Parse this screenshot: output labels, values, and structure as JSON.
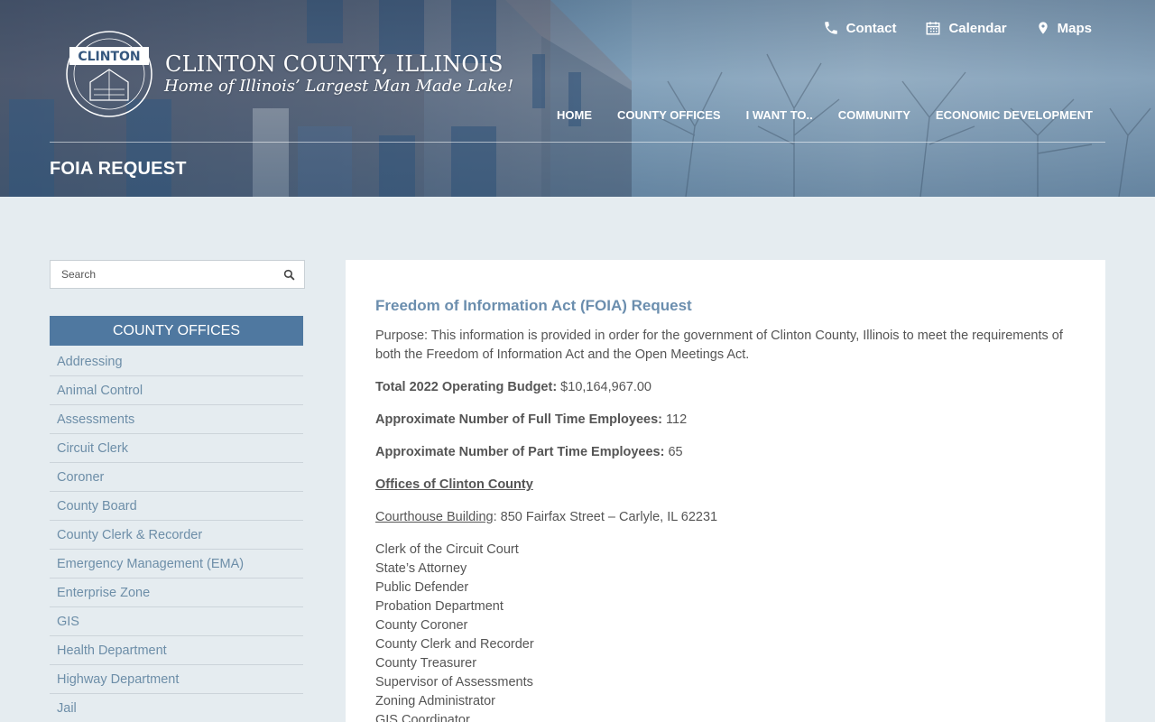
{
  "site": {
    "title": "CLINTON COUNTY, ILLINOIS",
    "tagline": "Home of Illinois’ Largest Man Made Lake!",
    "seal_label": "CLINTON"
  },
  "utility_nav": [
    {
      "label": "Contact",
      "icon": "phone-icon"
    },
    {
      "label": "Calendar",
      "icon": "calendar-icon"
    },
    {
      "label": "Maps",
      "icon": "map-pin-icon"
    }
  ],
  "main_nav": [
    "HOME",
    "COUNTY OFFICES",
    "I WANT TO..",
    "COMMUNITY",
    "ECONOMIC DEVELOPMENT"
  ],
  "page_title": "FOIA REQUEST",
  "sidebar": {
    "search_placeholder": "Search",
    "heading": "COUNTY OFFICES",
    "items": [
      "Addressing",
      "Animal Control",
      "Assessments",
      "Circuit Clerk",
      "Coroner",
      "County Board",
      "County Clerk & Recorder",
      "Emergency Management (EMA)",
      "Enterprise Zone",
      "GIS",
      "Health Department",
      "Highway Department",
      "Jail"
    ]
  },
  "content": {
    "heading": "Freedom of Information Act (FOIA) Request",
    "purpose": "Purpose: This information is provided in order for the government of Clinton County, Illinois to meet the requirements of both the Freedom of Information Act and the Open Meetings Act.",
    "budget_label": "Total 2022 Operating Budget:",
    "budget_value": " $10,164,967.00",
    "fulltime_label": "Approximate Number of Full Time Employees:",
    "fulltime_value": " 112",
    "parttime_label": "Approximate Number of Part Time Employees:",
    "parttime_value": " 65",
    "offices_heading": "Offices of Clinton County",
    "courthouse_label": "Courthouse Building",
    "courthouse_address": ": 850 Fairfax Street – Carlyle, IL 62231",
    "offices": [
      "Clerk of the Circuit Court",
      "State’s Attorney",
      "Public Defender",
      "Probation Department",
      "County Coroner",
      "County Clerk and Recorder",
      "County Treasurer",
      "Supervisor of Assessments",
      "Zoning Administrator",
      "GIS Coordinator"
    ]
  }
}
